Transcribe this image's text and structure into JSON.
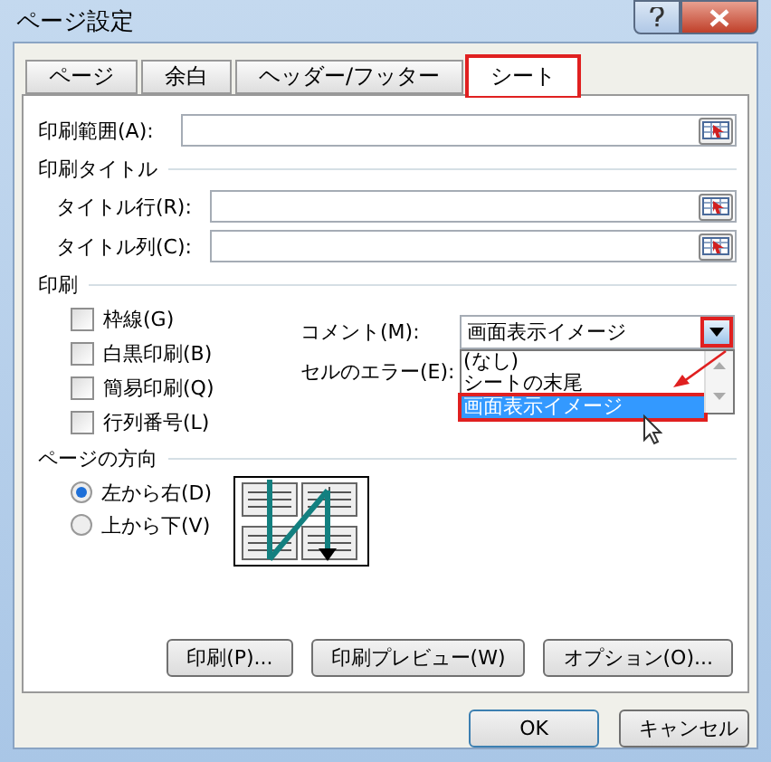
{
  "window": {
    "title": "ページ設定"
  },
  "tabs": [
    {
      "label": "ページ",
      "selected": false
    },
    {
      "label": "余白",
      "selected": false
    },
    {
      "label": "ヘッダー/フッター",
      "selected": false
    },
    {
      "label": "シート",
      "selected": true
    }
  ],
  "print_area": {
    "label": "印刷範囲(A):"
  },
  "print_titles": {
    "heading": "印刷タイトル",
    "rows": [
      {
        "label": "タイトル行(R):"
      },
      {
        "label": "タイトル列(C):"
      }
    ]
  },
  "print": {
    "heading": "印刷",
    "checkboxes": [
      {
        "label": "枠線(G)",
        "checked": false
      },
      {
        "label": "白黒印刷(B)",
        "checked": false
      },
      {
        "label": "簡易印刷(Q)",
        "checked": false
      },
      {
        "label": "行列番号(L)",
        "checked": false
      }
    ],
    "comments": {
      "label": "コメント(M):",
      "value": "画面表示イメージ",
      "options": [
        {
          "label": "(なし)",
          "selected": false
        },
        {
          "label": "シートの末尾",
          "selected": false
        },
        {
          "label": "画面表示イメージ",
          "selected": true
        }
      ]
    },
    "cell_errors": {
      "label": "セルのエラー(E):"
    }
  },
  "page_order": {
    "heading": "ページの方向",
    "options": [
      {
        "label": "左から右(D)",
        "selected": true
      },
      {
        "label": "上から下(V)",
        "selected": false
      }
    ]
  },
  "panel_buttons": [
    "印刷(P)...",
    "印刷プレビュー(W)",
    "オプション(O)..."
  ],
  "buttons": [
    {
      "label": "OK",
      "default": true
    },
    {
      "label": "キャンセル",
      "default": false
    }
  ]
}
